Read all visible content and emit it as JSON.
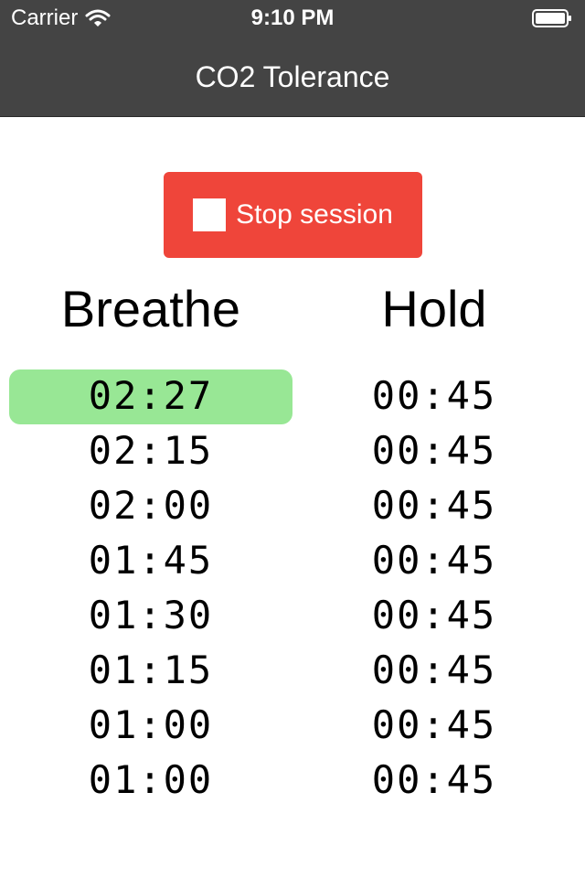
{
  "status_bar": {
    "carrier": "Carrier",
    "time": "9:10 PM"
  },
  "nav": {
    "title": "CO2 Tolerance"
  },
  "stop_button": {
    "label": "Stop session"
  },
  "columns": {
    "breathe": "Breathe",
    "hold": "Hold"
  },
  "rows": [
    {
      "breathe": "02:27",
      "hold": "00:45",
      "active": true
    },
    {
      "breathe": "02:15",
      "hold": "00:45"
    },
    {
      "breathe": "02:00",
      "hold": "00:45"
    },
    {
      "breathe": "01:45",
      "hold": "00:45"
    },
    {
      "breathe": "01:30",
      "hold": "00:45"
    },
    {
      "breathe": "01:15",
      "hold": "00:45"
    },
    {
      "breathe": "01:00",
      "hold": "00:45"
    },
    {
      "breathe": "01:00",
      "hold": "00:45"
    }
  ],
  "colors": {
    "header_bg": "#444444",
    "stop_button_bg": "#ef453a",
    "active_row_bg": "#98e795"
  },
  "icons": {
    "wifi": "wifi-icon",
    "battery": "battery-icon",
    "stop": "stop-icon"
  }
}
